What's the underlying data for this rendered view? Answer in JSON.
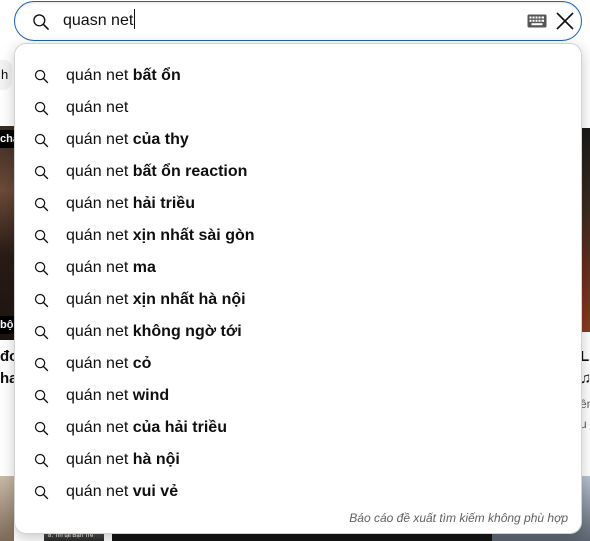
{
  "search": {
    "query": "quasn net"
  },
  "suggestions": [
    {
      "prefix": "quán net",
      "rest": " bất ổn"
    },
    {
      "prefix": "quán net",
      "rest": ""
    },
    {
      "prefix": "quán net",
      "rest": " của thy"
    },
    {
      "prefix": "quán net",
      "rest": " bất ổn reaction"
    },
    {
      "prefix": "quán net",
      "rest": " hải triều"
    },
    {
      "prefix": "quán net",
      "rest": " xịn nhất sài gòn"
    },
    {
      "prefix": "quán net",
      "rest": " ma"
    },
    {
      "prefix": "quán net",
      "rest": " xịn nhất hà nội"
    },
    {
      "prefix": "quán net",
      "rest": " không ngờ tới"
    },
    {
      "prefix": "quán net",
      "rest": " cỏ"
    },
    {
      "prefix": "quán net",
      "rest": " wind"
    },
    {
      "prefix": "quán net",
      "rest": " của hải triều"
    },
    {
      "prefix": "quán net",
      "rest": " hà nội"
    },
    {
      "prefix": "quán net",
      "rest": " vui vẻ"
    }
  ],
  "report_link": "Báo cáo đề xuất tìm kiếm không phù hợp",
  "background": {
    "chip_fragment": "h",
    "thumb_left_top": "cha",
    "thumb_left_bottom": "bộ",
    "video_title_left": "đơ\nha",
    "video_title_right": "L\n♫",
    "video_meta_right": "êm\nu",
    "strip_caption": "8. Tin tại Bận Trẻ"
  },
  "icons": {
    "search": "search-icon",
    "keyboard": "keyboard-icon",
    "clear": "close-icon",
    "suggestion": "search-icon"
  },
  "colors": {
    "focus_border": "#1c62b9",
    "text": "#0f0f0f",
    "secondary_text": "#606060"
  }
}
